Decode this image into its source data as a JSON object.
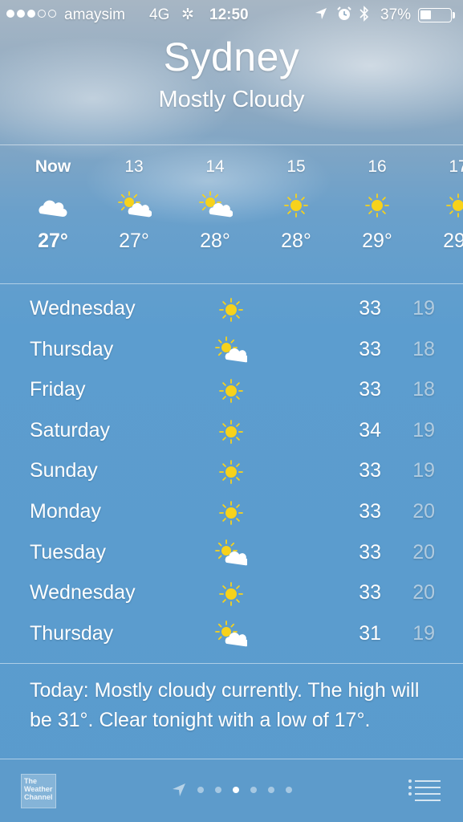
{
  "status_bar": {
    "carrier": "amaysim",
    "network": "4G",
    "time": "12:50",
    "battery_percent_label": "37%",
    "battery_level": 0.37,
    "signal_bars_filled": 3,
    "signal_bars_total": 5
  },
  "header": {
    "city": "Sydney",
    "condition": "Mostly Cloudy"
  },
  "hourly": [
    {
      "label": "Now",
      "icon": "cloud-icon",
      "temp": "27°"
    },
    {
      "label": "13",
      "icon": "partly-cloudy-icon",
      "temp": "27°"
    },
    {
      "label": "14",
      "icon": "partly-cloudy-icon",
      "temp": "28°"
    },
    {
      "label": "15",
      "icon": "sun-icon",
      "temp": "28°"
    },
    {
      "label": "16",
      "icon": "sun-icon",
      "temp": "29°"
    },
    {
      "label": "17",
      "icon": "sun-icon",
      "temp": "29°"
    }
  ],
  "daily": [
    {
      "day": "Wednesday",
      "icon": "sun-icon",
      "high": "33",
      "low": "19"
    },
    {
      "day": "Thursday",
      "icon": "partly-cloudy-icon",
      "high": "33",
      "low": "18"
    },
    {
      "day": "Friday",
      "icon": "sun-icon",
      "high": "33",
      "low": "18"
    },
    {
      "day": "Saturday",
      "icon": "sun-icon",
      "high": "34",
      "low": "19"
    },
    {
      "day": "Sunday",
      "icon": "sun-icon",
      "high": "33",
      "low": "19"
    },
    {
      "day": "Monday",
      "icon": "sun-icon",
      "high": "33",
      "low": "20"
    },
    {
      "day": "Tuesday",
      "icon": "partly-cloudy-icon",
      "high": "33",
      "low": "20"
    },
    {
      "day": "Wednesday",
      "icon": "sun-icon",
      "high": "33",
      "low": "20"
    },
    {
      "day": "Thursday",
      "icon": "partly-cloudy-icon",
      "high": "31",
      "low": "19"
    }
  ],
  "summary": "Today: Mostly cloudy currently. The high will be 31°. Clear tonight with a low of 17°.",
  "bottom_bar": {
    "logo_text": "The Weather Channel",
    "page_count": 6,
    "active_page": 2
  },
  "colors": {
    "sun": "#f7d21b",
    "background": "#5a9bcd"
  }
}
